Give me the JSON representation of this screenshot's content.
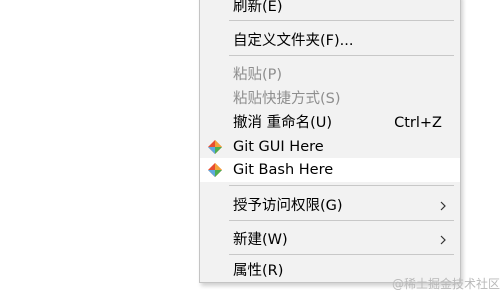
{
  "menu": {
    "items": [
      {
        "label": "刷新(E)",
        "shortcut": "",
        "disabled": false
      },
      {
        "label": "自定义文件夹(F)...",
        "shortcut": "",
        "disabled": false
      },
      {
        "label": "粘贴(P)",
        "shortcut": "",
        "disabled": true
      },
      {
        "label": "粘贴快捷方式(S)",
        "shortcut": "",
        "disabled": true
      },
      {
        "label": "撤消 重命名(U)",
        "shortcut": "Ctrl+Z",
        "disabled": false
      },
      {
        "label": "Git GUI Here",
        "shortcut": "",
        "disabled": false,
        "icon": "git-gui-icon"
      },
      {
        "label": "Git Bash Here",
        "shortcut": "",
        "disabled": false,
        "icon": "git-bash-icon",
        "highlighted": true
      },
      {
        "label": "授予访问权限(G)",
        "shortcut": "",
        "disabled": false,
        "submenu": true
      },
      {
        "label": "新建(W)",
        "shortcut": "",
        "disabled": false,
        "submenu": true
      },
      {
        "label": "属性(R)",
        "shortcut": "",
        "disabled": false
      }
    ]
  },
  "watermark": "@稀土掘金技术社区",
  "colors": {
    "menu_bg": "#f2f2f2",
    "hover_bg": "#ffffff",
    "disabled_text": "#8e8e8e",
    "separator": "#c8c8c8"
  }
}
